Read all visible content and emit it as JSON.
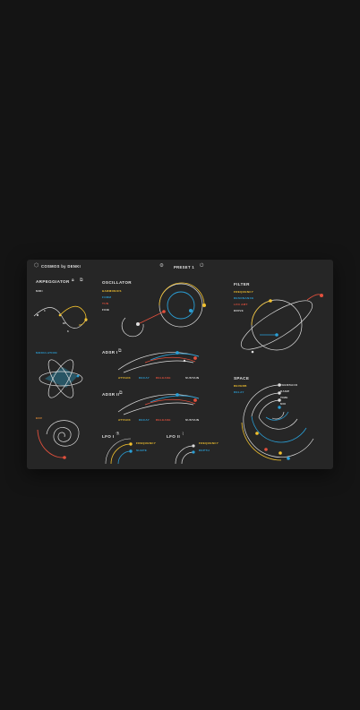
{
  "colors": {
    "background": "#141414",
    "panel": "#262626",
    "line": "#dedede",
    "yellow": "#f2c12e",
    "blue": "#2a9fd6",
    "red": "#e2503d",
    "orange": "#e08a36"
  },
  "header": {
    "logo_icon": "hexagon-logo-icon",
    "app_title": "COSMOS by DENKI",
    "settings_icon": "gear-icon",
    "preset_name": "PRESET 1",
    "power_icon": "power-icon"
  },
  "arpeggiator": {
    "title": "ARPEGGIATOR",
    "lock_icon": "lock-icon",
    "param": "MIDI",
    "labels": [
      "C",
      "K",
      "BP",
      "C"
    ]
  },
  "oscillator": {
    "title": "OSCILLATOR",
    "params": [
      "HARMONICS",
      "FORM",
      "TUN",
      "FINE"
    ]
  },
  "filter": {
    "title": "FILTER",
    "params": [
      "FREQUENCY",
      "RESONANCE",
      "LFO AMT",
      "DRIVE"
    ]
  },
  "modulation": {
    "label": "MODULATION"
  },
  "envelope": {
    "label": "ENV"
  },
  "adsr1": {
    "title": "ADSR I",
    "params": [
      "ATTACK",
      "DECAY",
      "RELEASE",
      "SUSTAIN"
    ]
  },
  "adsr2": {
    "title": "ADSR II",
    "params": [
      "ATTACK",
      "DECAY",
      "RELEASE",
      "SUSTAIN"
    ]
  },
  "lfo1": {
    "title": "LFO I",
    "params": [
      "FREQUENCY",
      "SHAPE"
    ]
  },
  "lfo2": {
    "title": "LFO II",
    "params": [
      "FREQUENCY",
      "DEPTH"
    ]
  },
  "space": {
    "title": "SPACE",
    "params": [
      "REVERB",
      "DELAY"
    ],
    "ring_params": [
      "FEEDBACK",
      "DAMP",
      "TIME",
      "MIX"
    ]
  }
}
